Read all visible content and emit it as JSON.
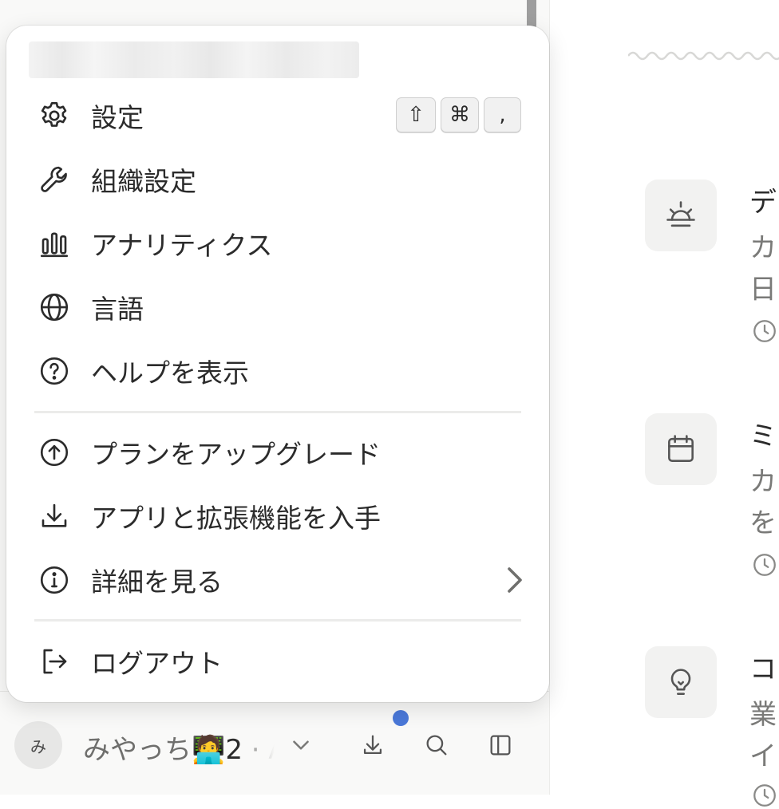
{
  "menu": {
    "items": [
      {
        "label": "設定",
        "icon": "gear-icon"
      },
      {
        "label": "組織設定",
        "icon": "wrench-icon"
      },
      {
        "label": "アナリティクス",
        "icon": "bar-chart-icon"
      },
      {
        "label": "言語",
        "icon": "globe-icon"
      },
      {
        "label": "ヘルプを表示",
        "icon": "help-circle-icon"
      },
      {
        "label": "プランをアップグレード",
        "icon": "arrow-up-circle-icon"
      },
      {
        "label": "アプリと拡張機能を入手",
        "icon": "download-icon"
      },
      {
        "label": "詳細を見る",
        "icon": "info-circle-icon"
      },
      {
        "label": "ログアウト",
        "icon": "logout-icon"
      }
    ],
    "shortcut": {
      "shift": "⇧",
      "cmd": "⌘",
      "comma": ","
    }
  },
  "bottom_bar": {
    "avatar_initial": "み",
    "username": "みやっち🧑‍💻",
    "username_num": "2",
    "username_suffix": " · A"
  },
  "main": {
    "cards": [
      {
        "icon": "sunrise-icon",
        "title": "デ",
        "line1": "カ",
        "line2": "日"
      },
      {
        "icon": "calendar-icon",
        "title": "ミ",
        "line1": "カ",
        "line2": "を"
      },
      {
        "icon": "lightbulb-icon",
        "title": "コ",
        "line1": "業",
        "line2": "イ"
      }
    ]
  },
  "colors": {
    "accent_dot": "#4a78d8",
    "text": "#2b2b2b",
    "muted": "#7a7a78"
  }
}
